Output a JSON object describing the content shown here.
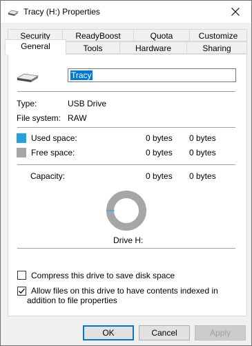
{
  "window": {
    "title": "Tracy (H:) Properties"
  },
  "tabs_row1": [
    "Security",
    "ReadyBoost",
    "Quota",
    "Customize"
  ],
  "tabs_row2": [
    "General",
    "Tools",
    "Hardware",
    "Sharing"
  ],
  "active_tab": "General",
  "general": {
    "drive_name": "Tracy",
    "type_label": "Type:",
    "type_value": "USB Drive",
    "fs_label": "File system:",
    "fs_value": "RAW",
    "used_label": "Used space:",
    "used_bytes": "0 bytes",
    "used_gb": "0 bytes",
    "free_label": "Free space:",
    "free_bytes": "0 bytes",
    "free_gb": "0 bytes",
    "capacity_label": "Capacity:",
    "capacity_bytes": "0 bytes",
    "capacity_gb": "0 bytes",
    "drive_caption": "Drive H:",
    "compress_label": "Compress this drive to save disk space",
    "compress_checked": false,
    "index_label": "Allow files on this drive to have contents indexed in addition to file properties",
    "index_checked": true
  },
  "colors": {
    "used": "#26a0da",
    "free": "#a6a6a6",
    "accent": "#0078d7"
  },
  "buttons": {
    "ok": "OK",
    "cancel": "Cancel",
    "apply": "Apply"
  }
}
